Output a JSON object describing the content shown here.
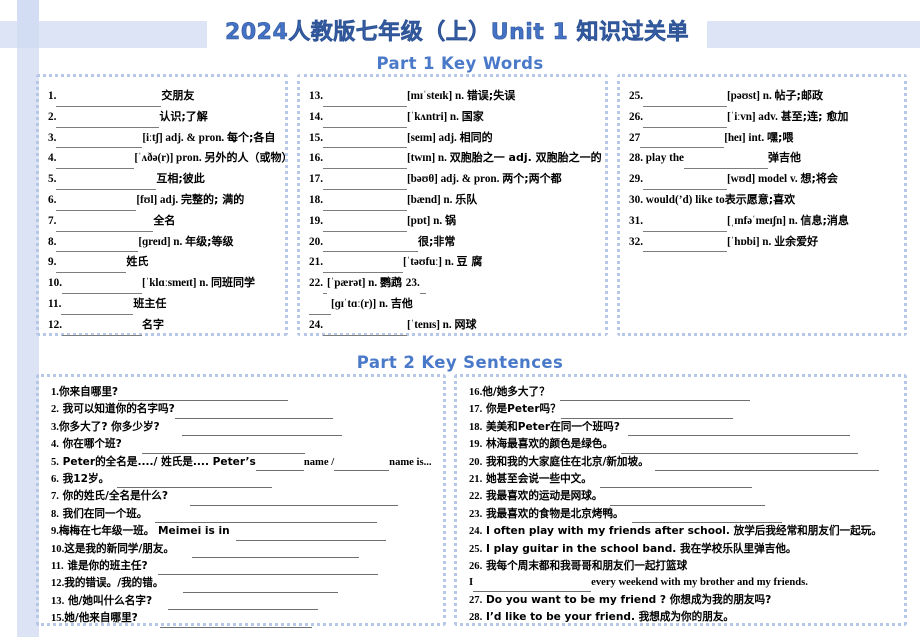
{
  "document": {
    "title": "2024人教版七年级（上）Unit 1  知识过关单",
    "accent_color": "#4472c4",
    "band_color": "#dce4f6",
    "dot_border_color": "#b6c7e8"
  },
  "part1": {
    "heading": "Part 1 Key  Words",
    "columns": [
      {
        "id": "p1-col-1",
        "items": [
          {
            "num": "1.",
            "blank": 105,
            "ipa": "",
            "pos": "",
            "cn": "交朋友"
          },
          {
            "num": "2.",
            "blank": 103,
            "ipa": "",
            "pos": "",
            "cn": "认识;了解"
          },
          {
            "num": "3.",
            "blank": 86,
            "ipa": "[iːtʃ]",
            "pos": "adj. & pron.",
            "cn": "每个;各自"
          },
          {
            "num": "4.",
            "blank": 78,
            "ipa": "[ˈʌðə(r)]",
            "pos": "pron.",
            "cn": "另外的人（或物）"
          },
          {
            "num": "5.",
            "blank": 100,
            "ipa": "",
            "pos": "",
            "cn": "互相;彼此"
          },
          {
            "num": "6.",
            "blank": 80,
            "ipa": "[fʊl]",
            "pos": "adj.",
            "cn": "完整的; 满的"
          },
          {
            "num": "7.",
            "blank": 97,
            "ipa": "",
            "pos": "",
            "cn": "全名"
          },
          {
            "num": "8.",
            "blank": 82,
            "ipa": "[ɡreɪd]",
            "pos": "n.",
            "cn": "年级;等级"
          },
          {
            "num": "9.",
            "blank": 70,
            "ipa": "",
            "pos": "",
            "cn": "姓氏"
          },
          {
            "num": "10.",
            "blank": 80,
            "ipa": "[ˈklɑːsmeɪt]",
            "pos": "n.",
            "cn": "同班同学"
          },
          {
            "num": "11.",
            "blank": 72,
            "ipa": "",
            "pos": "",
            "cn": "班主任"
          },
          {
            "num": "12.",
            "blank": 80,
            "ipa": "",
            "pos": "",
            "cn": "名字"
          }
        ]
      },
      {
        "id": "p1-col-2",
        "items": [
          {
            "num": "13.",
            "blank": 84,
            "ipa": "[mɪˈsteɪk]",
            "pos": "n.",
            "cn": "错误;失误"
          },
          {
            "num": "14.",
            "blank": 84,
            "ipa": "[ˈkʌntri]",
            "pos": "n.",
            "cn": "国家"
          },
          {
            "num": "15.",
            "blank": 84,
            "ipa": "[seɪm]",
            "pos": "adj.",
            "cn": "相同的"
          },
          {
            "num": "16.",
            "blank": 84,
            "ipa": "[twɪn]",
            "pos": "n.",
            "cn": "双胞胎之一 adj. 双胞胎之一的"
          },
          {
            "num": "17.",
            "blank": 84,
            "ipa": "[bəʊθ]",
            "pos": "adj. & pron.",
            "cn": "两个;两个都"
          },
          {
            "num": "18.",
            "blank": 84,
            "ipa": "[bænd]",
            "pos": "n.",
            "cn": "乐队"
          },
          {
            "num": "19.",
            "blank": 84,
            "ipa": "[pɒt]",
            "pos": "n.",
            "cn": "锅"
          },
          {
            "num": "20.",
            "blank": 95,
            "ipa": "",
            "pos": "",
            "cn": "很;非常"
          },
          {
            "num": "21.",
            "blank": 80,
            "ipa": "[ˈtəʊfuː]",
            "pos": " n.",
            "cn": " 豆 腐"
          }
        ],
        "item22": {
          "num": "22.",
          "blank": 4,
          "ipa": "[ˈpærət]",
          "pos": "n.",
          "cn": "鹦鹉",
          "tail_num": "23.",
          "tail_blank": 6
        },
        "item23": {
          "blank": 22,
          "ipa": "[ɡɪˈtɑː(r)]",
          "pos": "n.",
          "cn": "吉他"
        },
        "item24": {
          "num": "24.",
          "blank": 84,
          "ipa": "[ˈtenɪs]",
          "pos": "n.",
          "cn": "网球"
        }
      },
      {
        "id": "p1-col-3",
        "items": [
          {
            "num": "25.",
            "blank": 84,
            "ipa": "[pəʊst]",
            "pos": "n.",
            "cn": "帖子;邮政"
          },
          {
            "num": "26.",
            "blank": 84,
            "ipa": "[ˈiːvn]",
            "pos": "adv.",
            "cn": "甚至;连; 愈加"
          },
          {
            "num": "27",
            "blank": 84,
            "ipa": "[heɪ]",
            "pos": "int.",
            "cn": "嘿;喂"
          },
          {
            "num": "28. play the",
            "blank": 84,
            "ipa": "",
            "pos": "",
            "cn": "弹吉他"
          },
          {
            "num": "29.",
            "blank": 84,
            "ipa": "[wʊd]",
            "pos": "model v.",
            "cn": "想;将会"
          },
          {
            "num": "30. would(’d) like to",
            "blank": 0,
            "ipa": "",
            "pos": "",
            "cn": "表示愿意;喜欢"
          },
          {
            "num": "31.",
            "blank": 84,
            "ipa": "[ˌɪnfəˈmeɪʃn]",
            "pos": "n.",
            "cn": "信息;消息"
          },
          {
            "num": "32.",
            "blank": 84,
            "ipa": "[ˈhɒbi]",
            "pos": "n.",
            "cn": "业余爱好"
          }
        ]
      }
    ]
  },
  "part2": {
    "heading": "Part 2 Key Sentences",
    "columns": [
      {
        "id": "p2-col-1",
        "items": [
          {
            "num": "1.",
            "text": "你来自哪里?",
            "line": 170,
            "indent": 0,
            "lang": "cn"
          },
          {
            "num": "2.",
            "text": " 我可以知道你的名字吗?",
            "line": 158,
            "indent": 0,
            "lang": "cn"
          },
          {
            "num": "3.",
            "text": "你多大了? 你多少岁?",
            "line": 160,
            "indent": 22,
            "lang": "cn"
          },
          {
            "num": "4.",
            "text": " 你在哪个班?",
            "line": 163,
            "indent": 20,
            "lang": "cn"
          },
          {
            "num": "5.",
            "text": " Peter的全名是..../ 姓氏是....    Peter’s",
            "line": 0,
            "indent": 0,
            "lang": "mix",
            "suffix": [
              {
                "line": 48
              },
              {
                "t": "name /"
              },
              {
                "line": 55
              },
              {
                "t": "name is..."
              }
            ]
          },
          {
            "num": "6.",
            "text": " 我12岁。",
            "line": 155,
            "indent": 8,
            "lang": "cn"
          },
          {
            "num": "7.",
            "text": " 你的姓氏/全名是什么?",
            "line": 208,
            "indent": 22,
            "lang": "cn"
          },
          {
            "num": "8.",
            "text": " 我们在同一个班。",
            "line": 222,
            "indent": 8,
            "lang": "cn"
          },
          {
            "num": "9.",
            "text": "梅梅在七年级一班。 Meimei is in",
            "line": 150,
            "indent": 6,
            "lang": "mix"
          },
          {
            "num": "10.",
            "text": "这是我的新同学/朋友。",
            "line": 167,
            "indent": 18,
            "lang": "cn"
          },
          {
            "num": "11.",
            "text": " 谁是你的班主任?",
            "line": 220,
            "indent": 10,
            "lang": "cn"
          },
          {
            "num": "12.",
            "text": "我的错误。/我的错。",
            "line": 155,
            "indent": 20,
            "lang": "cn"
          },
          {
            "num": "13.",
            "text": " 他/她叫什么名字?",
            "line": 150,
            "indent": 16,
            "lang": "cn"
          },
          {
            "num": "15.",
            "text": "她/他来自哪里?",
            "line": 152,
            "indent": 22,
            "lang": "cn"
          }
        ]
      },
      {
        "id": "p2-col-2",
        "items": [
          {
            "num": "16.",
            "text": "他/她多大了？",
            "line": 190,
            "indent": 10,
            "lang": "cn"
          },
          {
            "num": "17.",
            "text": " 你是Peter吗？",
            "line": 172,
            "indent": 0,
            "lang": "mix"
          },
          {
            "num": "18.",
            "text": " 美美和Peter在同一个班吗?",
            "line": 222,
            "indent": 8,
            "lang": "mix"
          },
          {
            "num": "19.",
            "text": " 林海最喜欢的颜色是绿色。",
            "line": 237,
            "indent": 8,
            "lang": "cn"
          },
          {
            "num": "20.",
            "text": " 我和我的大家庭住在北京/新加坡。",
            "line": 224,
            "indent": 6,
            "lang": "cn"
          },
          {
            "num": "21.",
            "text": " 她甚至会说一些中文。",
            "line": 152,
            "indent": 8,
            "lang": "cn"
          },
          {
            "num": "22.",
            "text": " 我最喜欢的运动是网球。",
            "line": 155,
            "indent": 8,
            "lang": "cn"
          },
          {
            "num": "23.",
            "text": " 我最喜欢的食物是北京烤鸭。",
            "line": 150,
            "indent": 8,
            "lang": "cn"
          },
          {
            "num": "24.",
            "text": " I often play with my friends after school.  放学后我经常和朋友们一起玩。",
            "line": 0,
            "indent": 0,
            "lang": "mix"
          },
          {
            "num": "25.",
            "text": " I play guitar in the school band. 我在学校乐队里弹吉他。",
            "line": 0,
            "indent": 0,
            "lang": "mix"
          },
          {
            "num": "26.",
            "text": " 我每个周末都和我哥哥和朋友们一起打篮球",
            "line": 0,
            "indent": 0,
            "lang": "cn"
          },
          {
            "num": "",
            "text": "I",
            "line": 118,
            "indent": 0,
            "lang": "en",
            "after": "every weekend with my brother and my friends."
          },
          {
            "num": "27.",
            "text": " Do you want to be my friend ?  你想成为我的朋友吗?",
            "line": 0,
            "indent": 0,
            "lang": "mix"
          },
          {
            "num": "28.",
            "text": " I’d like to be your friend.  我想成为你的朋友。",
            "line": 0,
            "indent": 0,
            "lang": "mix"
          }
        ]
      }
    ]
  }
}
